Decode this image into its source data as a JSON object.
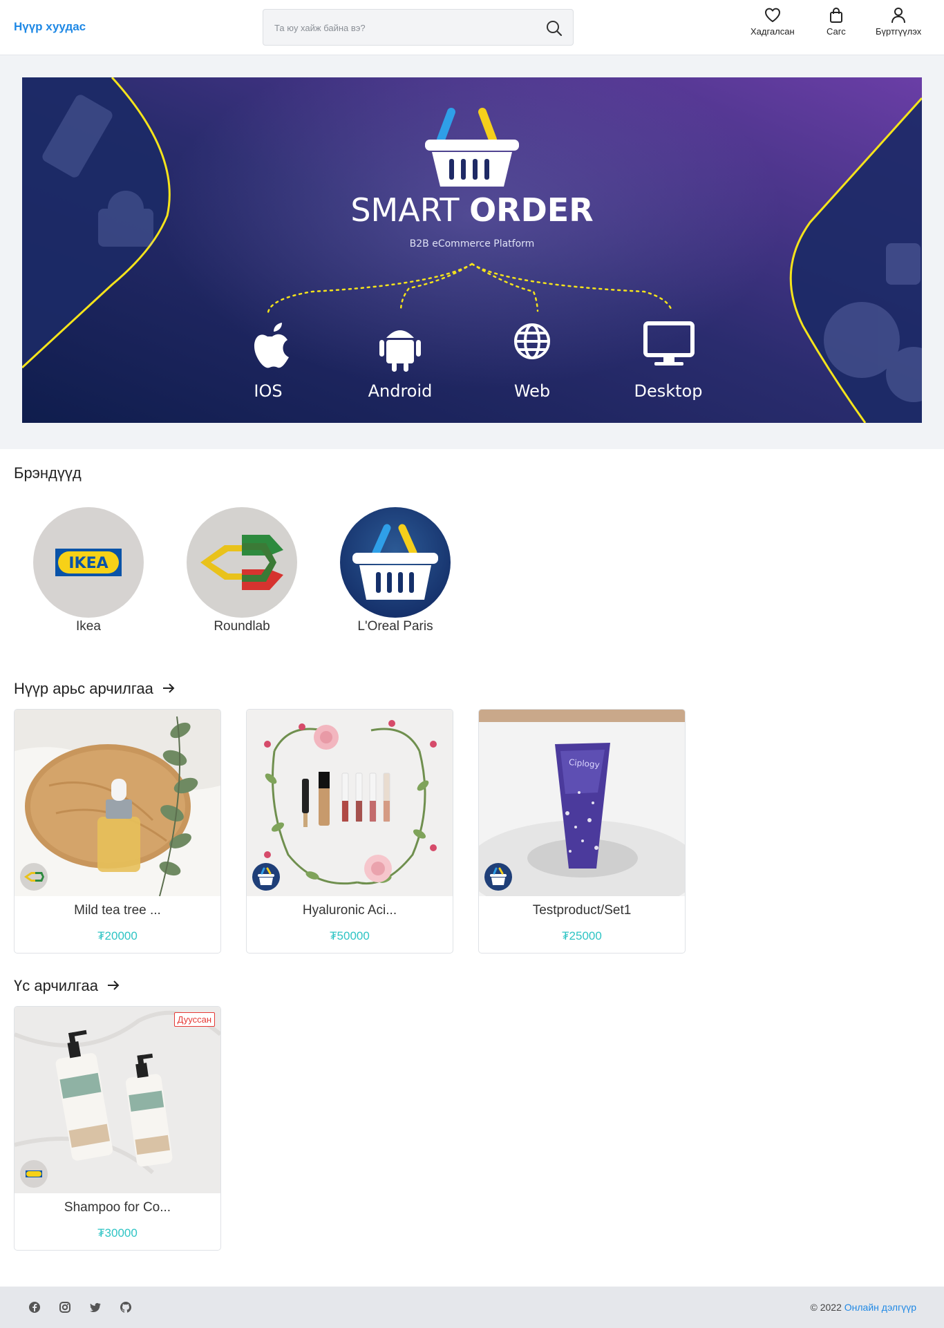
{
  "header": {
    "logo": "Нүүр хуудас",
    "search_placeholder": "Та юу хайж байна вэ?",
    "nav": {
      "saved": "Хадгалсан",
      "cart": "Сагс",
      "register": "Бүртгүүлэх"
    }
  },
  "banner": {
    "title_light": "SMART",
    "title_bold": "ORDER",
    "subtitle": "B2B eCommerce Platform",
    "platforms": [
      "IOS",
      "Android",
      "Web",
      "Desktop"
    ],
    "slides_count": 3,
    "active_slide": 1
  },
  "brands_section": {
    "title": "Брэндүүд",
    "items": [
      {
        "name": "Ikea",
        "logo_text": "IKEA"
      },
      {
        "name": "Roundlab"
      },
      {
        "name": "L'Oreal Paris"
      }
    ]
  },
  "face_care": {
    "title": "Нүүр арьс арчилгаа",
    "products": [
      {
        "title": "Mild tea tree ...",
        "price": "₮20000"
      },
      {
        "title": "Hyaluronic Aci...",
        "price": "₮50000"
      },
      {
        "title": "Testproduct/Set1",
        "price": "₮25000",
        "image_text": "Ciplogy"
      }
    ]
  },
  "hair_care": {
    "title": "Үс арчилгаа",
    "products": [
      {
        "title": "Shampoo for Co...",
        "price": "₮30000",
        "badge": "Дууссан"
      }
    ]
  },
  "footer": {
    "copyright": "© 2022",
    "link": "Онлайн дэлгүүр",
    "social": [
      "facebook-icon",
      "instagram-icon",
      "twitter-icon",
      "github-icon"
    ]
  },
  "colors": {
    "accent": "#1e88e5",
    "price": "#2ec4c4",
    "sold": "#e53935",
    "banner_dark": "#1a2560",
    "banner_purple": "#5e3ea0",
    "highlight_yellow": "#f5e41b"
  }
}
